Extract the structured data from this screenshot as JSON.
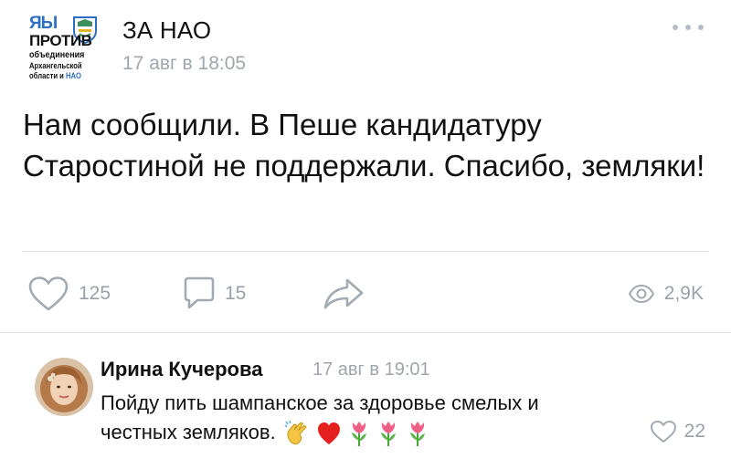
{
  "post": {
    "logo_text": {
      "line1": "ЯЫ",
      "line2": "ПРОТИВ",
      "line3": "объединения",
      "line4": "Архангельской",
      "line5_prefix": "области и ",
      "line5_suffix": "НАО"
    },
    "community_name": "ЗА НАО",
    "date": "17 авг в 18:05",
    "text": "Нам сообщили. В Пеше кандидатуру Старостиной не поддержали. Спасибо, земляки!",
    "likes": "125",
    "comments": "15",
    "views": "2,9K",
    "icons": {
      "like": "heart-outline-icon",
      "comment": "comment-bubble-icon",
      "share": "share-arrow-icon",
      "views": "eye-icon",
      "more": "more-dots-icon"
    }
  },
  "comment": {
    "author": "Ирина Кучерова",
    "time": "17 авг в 19:01",
    "text": "Пойду пить шампанское за здоровье смелых и честных земляков.",
    "emojis": [
      "clapping-hands-emoji",
      "red-heart-emoji",
      "tulip-emoji",
      "tulip-emoji",
      "tulip-emoji"
    ],
    "likes": "22"
  },
  "colors": {
    "text": "#111111",
    "muted": "#9aa1a9",
    "divider": "#e4e6ea",
    "logo_blue": "#2c6fc2"
  }
}
